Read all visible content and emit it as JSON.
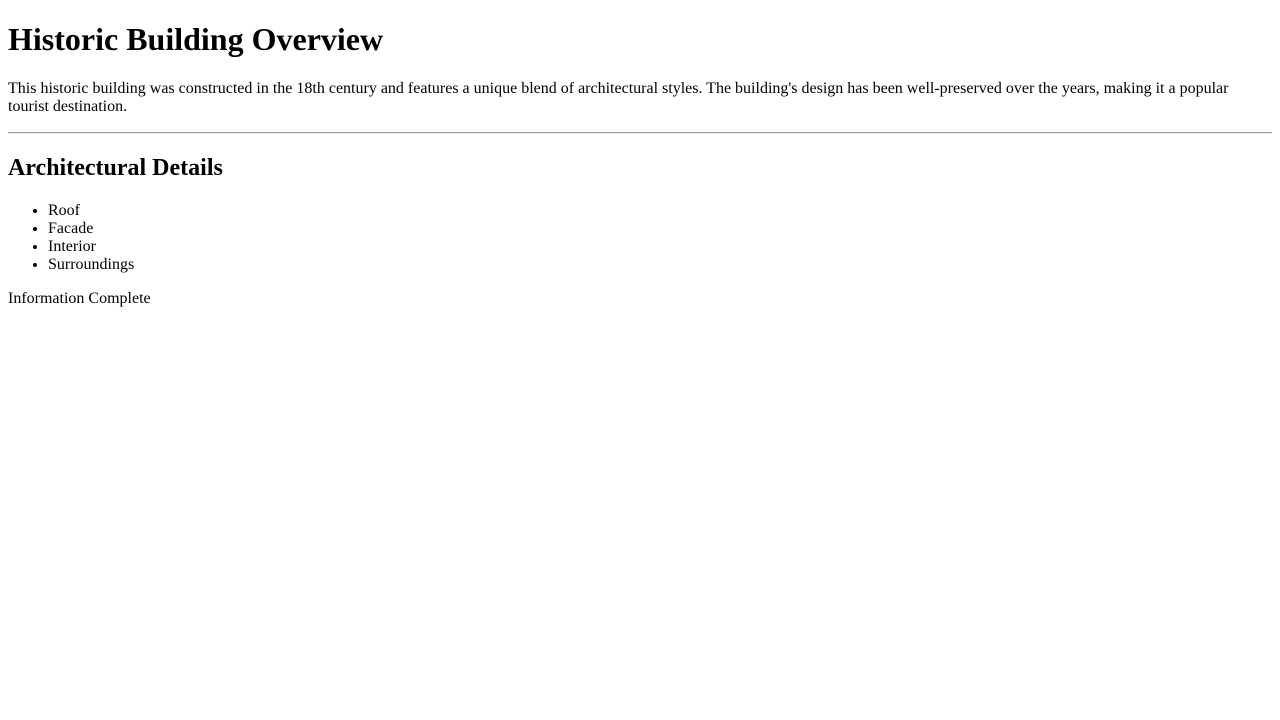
{
  "page": {
    "title": "Historic Building Overview",
    "intro": "This historic building was constructed in the 18th century and features a unique blend of architectural styles. The building's design has been well-preserved over the years, making it a popular tourist destination."
  },
  "details": {
    "heading": "Architectural Details",
    "items": [
      {
        "label": "Roof"
      },
      {
        "label": "Facade"
      },
      {
        "label": "Interior"
      },
      {
        "label": "Surroundings"
      }
    ]
  },
  "status": {
    "text": "Information Complete"
  }
}
